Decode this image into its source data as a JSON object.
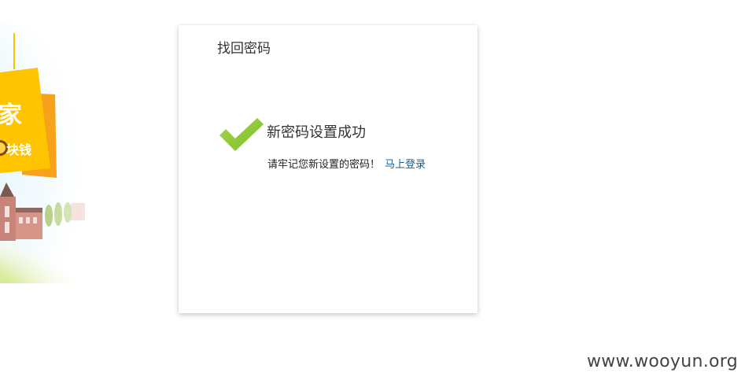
{
  "banner": {
    "sign_text_top": "家",
    "sign_text_bottom": "块钱"
  },
  "card": {
    "title": "找回密码",
    "success_title": "新密码设置成功",
    "message": "请牢记您新设置的密码！",
    "login_link": "马上登录"
  },
  "watermark": "www.wooyun.org",
  "colors": {
    "check_green": "#8cc63e",
    "link_blue": "#1a5c8c",
    "sign_yellow": "#ffc107",
    "sign_orange": "#f7a21b"
  }
}
